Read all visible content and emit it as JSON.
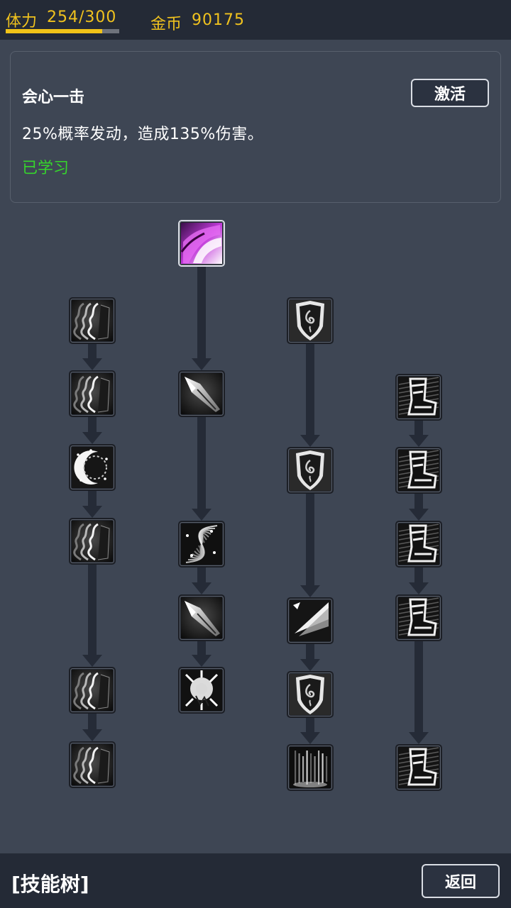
{
  "header": {
    "stamina_label": "体力",
    "stamina_value": "254/300",
    "stamina_fraction": 0.847,
    "gold_label": "金币",
    "gold_value": "90175"
  },
  "skill_panel": {
    "name": "会心一击",
    "description": "25%概率发动，造成135%伤害。",
    "status": "已学习",
    "activate_label": "激活"
  },
  "footer": {
    "title": "[技能树]",
    "back_label": "返回"
  },
  "skill_tree": {
    "nodes": [
      {
        "icon": "crimson-slash-icon",
        "selected": true
      },
      {
        "icon": "shadow-face-icon"
      },
      {
        "icon": "shadow-face-icon"
      },
      {
        "icon": "glowing-crescent-icon"
      },
      {
        "icon": "shadow-face-icon"
      },
      {
        "icon": "shadow-face-icon"
      },
      {
        "icon": "shadow-face-icon"
      },
      {
        "icon": "spearhead-icon"
      },
      {
        "icon": "feather-burst-icon"
      },
      {
        "icon": "spearhead-icon"
      },
      {
        "icon": "shatter-icon"
      },
      {
        "icon": "shield-rune-icon"
      },
      {
        "icon": "shield-rune-icon"
      },
      {
        "icon": "swift-strike-icon"
      },
      {
        "icon": "shield-rune-icon"
      },
      {
        "icon": "light-pillar-icon"
      },
      {
        "icon": "iron-boot-icon"
      },
      {
        "icon": "iron-boot-icon"
      },
      {
        "icon": "iron-boot-icon"
      },
      {
        "icon": "iron-boot-icon"
      },
      {
        "icon": "iron-boot-icon"
      }
    ]
  },
  "colors": {
    "accent": "#f0c21e",
    "learned": "#36d52c",
    "background": "#3e4654",
    "bar": "#242a36",
    "connector": "#252b37"
  }
}
